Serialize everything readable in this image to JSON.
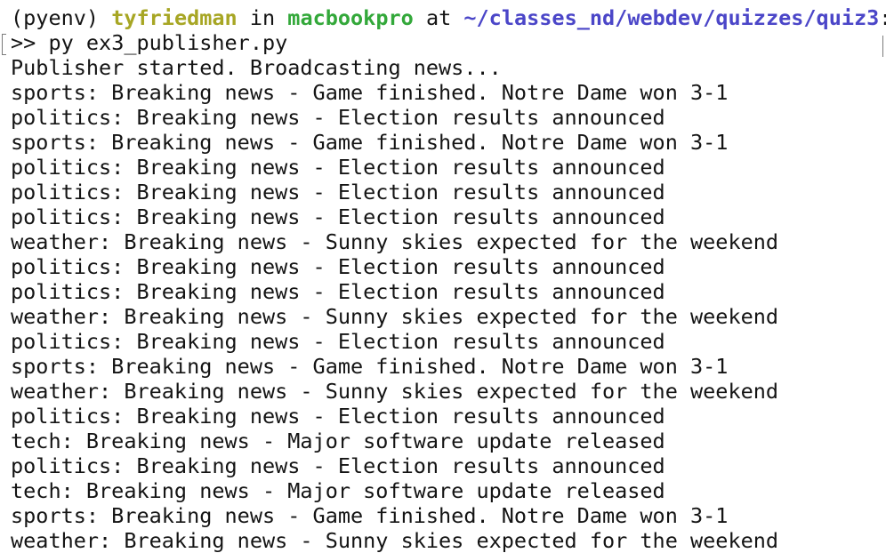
{
  "prompt": {
    "env": "(pyenv)",
    "user": "tyfriedman",
    "in": "in",
    "host": "macbookpro",
    "at": "at",
    "path": "~/classes_nd/webdev/quizzes/quiz3",
    "suffix": ":"
  },
  "command": {
    "prompt_symbol": ">>",
    "text": "py ex3_publisher.py"
  },
  "output": [
    "Publisher started. Broadcasting news...",
    "sports: Breaking news - Game finished. Notre Dame won 3-1",
    "politics: Breaking news - Election results announced",
    "sports: Breaking news - Game finished. Notre Dame won 3-1",
    "politics: Breaking news - Election results announced",
    "politics: Breaking news - Election results announced",
    "politics: Breaking news - Election results announced",
    "weather: Breaking news - Sunny skies expected for the weekend",
    "politics: Breaking news - Election results announced",
    "politics: Breaking news - Election results announced",
    "weather: Breaking news - Sunny skies expected for the weekend",
    "politics: Breaking news - Election results announced",
    "sports: Breaking news - Game finished. Notre Dame won 3-1",
    "weather: Breaking news - Sunny skies expected for the weekend",
    "politics: Breaking news - Election results announced",
    "tech: Breaking news - Major software update released",
    "politics: Breaking news - Election results announced",
    "tech: Breaking news - Major software update released",
    "sports: Breaking news - Game finished. Notre Dame won 3-1",
    "weather: Breaking news - Sunny skies expected for the weekend"
  ],
  "colors": {
    "user": "#a7a624",
    "host": "#33a83a",
    "path": "#4b46c8",
    "text": "#141414",
    "background": "#ffffff"
  }
}
